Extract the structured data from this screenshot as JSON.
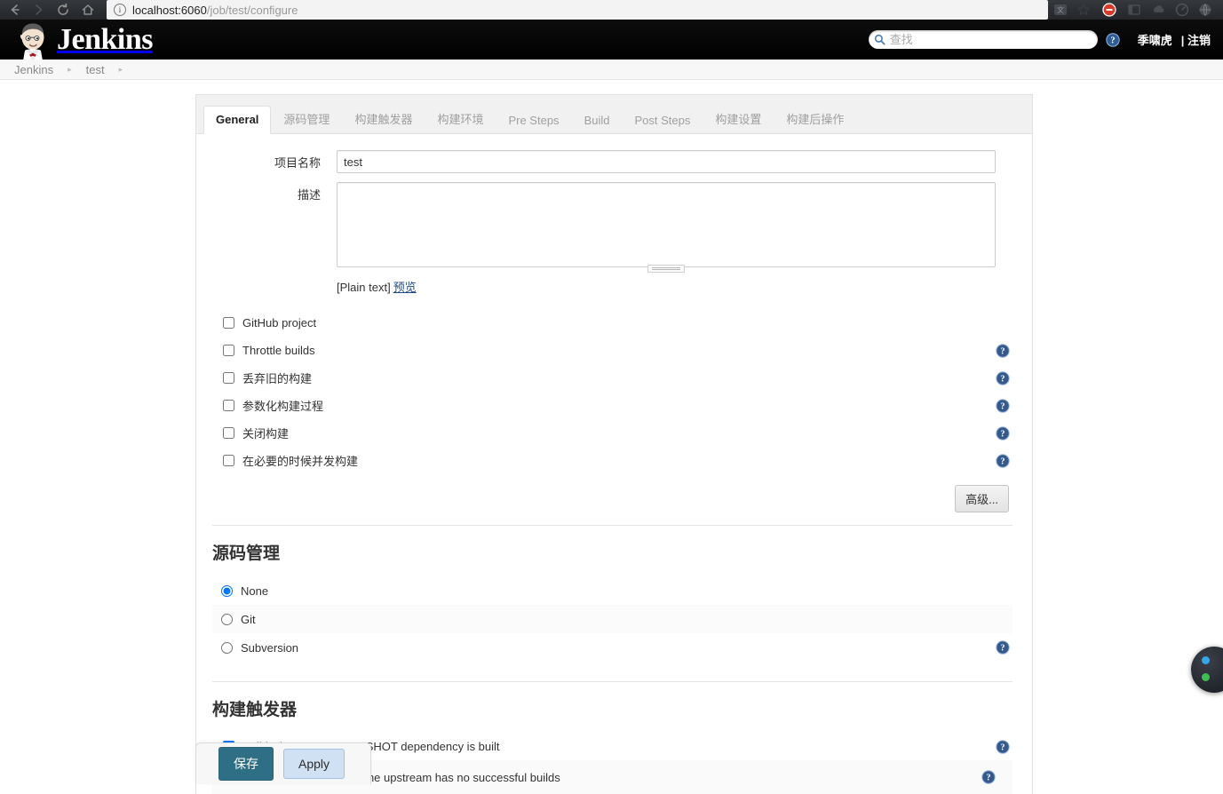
{
  "browser": {
    "url_host": "localhost:6060",
    "url_path": "/job/test/configure",
    "nav": {
      "back": "back-arrow",
      "forward": "forward-arrow",
      "reload": "reload",
      "home": "home"
    }
  },
  "header": {
    "brand": "Jenkins",
    "search_placeholder": "查找",
    "search_value": "",
    "user_name": "季啸虎",
    "logout_label": "| 注销"
  },
  "breadcrumb": {
    "items": [
      "Jenkins",
      "test"
    ],
    "separator": "▸"
  },
  "tabs": [
    {
      "label": "General",
      "active": true
    },
    {
      "label": "源码管理",
      "active": false
    },
    {
      "label": "构建触发器",
      "active": false
    },
    {
      "label": "构建环境",
      "active": false
    },
    {
      "label": "Pre Steps",
      "active": false
    },
    {
      "label": "Build",
      "active": false
    },
    {
      "label": "Post Steps",
      "active": false
    },
    {
      "label": "构建设置",
      "active": false
    },
    {
      "label": "构建后操作",
      "active": false
    }
  ],
  "general": {
    "project_name_label": "项目名称",
    "project_name_value": "test",
    "description_label": "描述",
    "description_value": "",
    "description_markup_note": "[Plain text]",
    "preview_link": "预览",
    "checkboxes": [
      {
        "label": "GitHub project",
        "checked": false,
        "help": true
      },
      {
        "label": "Throttle builds",
        "checked": false,
        "help": true
      },
      {
        "label": "丢弃旧的构建",
        "checked": false,
        "help": true
      },
      {
        "label": "参数化构建过程",
        "checked": false,
        "help": true
      },
      {
        "label": "关闭构建",
        "checked": false,
        "help": true
      },
      {
        "label": "在必要的时候并发构建",
        "checked": false,
        "help": true
      }
    ],
    "advanced_button": "高级..."
  },
  "scm": {
    "title": "源码管理",
    "options": [
      {
        "label": "None",
        "selected": true,
        "help": false
      },
      {
        "label": "Git",
        "selected": false,
        "help": false
      },
      {
        "label": "Subversion",
        "selected": false,
        "help": true
      }
    ]
  },
  "triggers": {
    "title": "构建触发器",
    "items": [
      {
        "label": "Build whenever a SNAPSHOT dependency is built",
        "checked": true,
        "help": true
      },
      {
        "label": "Schedule build when some upstream has no successful builds",
        "checked": false,
        "help": true
      }
    ]
  },
  "save_bar": {
    "save_label": "保存",
    "apply_label": "Apply"
  },
  "colors": {
    "header_bg": "#000000",
    "save_button": "#2f6f86",
    "apply_button": "#cfe1f2",
    "link": "#204a87",
    "help_icon": "#3b6ea5"
  }
}
